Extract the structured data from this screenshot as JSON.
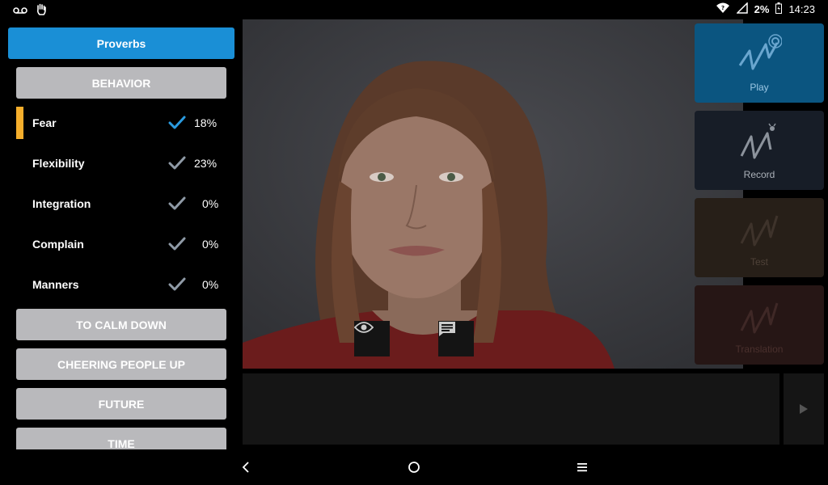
{
  "status_bar": {
    "icons_left": [
      "voicemail-icon",
      "hand-icon"
    ],
    "battery": "2%",
    "time": "14:23"
  },
  "sidebar": {
    "header_button": "Proverbs",
    "active_category": "BEHAVIOR",
    "items": [
      {
        "label": "Fear",
        "percent": "18%",
        "active": true
      },
      {
        "label": "Flexibility",
        "percent": "23%",
        "active": false
      },
      {
        "label": "Integration",
        "percent": "0%",
        "active": false
      },
      {
        "label": "Complain",
        "percent": "0%",
        "active": false
      },
      {
        "label": "Manners",
        "percent": "0%",
        "active": false
      }
    ],
    "categories": [
      "TO CALM DOWN",
      "CHEERING PEOPLE UP",
      "FUTURE",
      "TIME"
    ]
  },
  "actions": {
    "play": "Play",
    "record": "Record",
    "test": "Test",
    "translation": "Translation"
  },
  "colors": {
    "accent_blue": "#1a8fd6",
    "active_marker": "#f5ae2c",
    "category_gray": "#b9b9bc",
    "check_active": "#2a9be0",
    "check_inactive": "#8f9aa6"
  }
}
